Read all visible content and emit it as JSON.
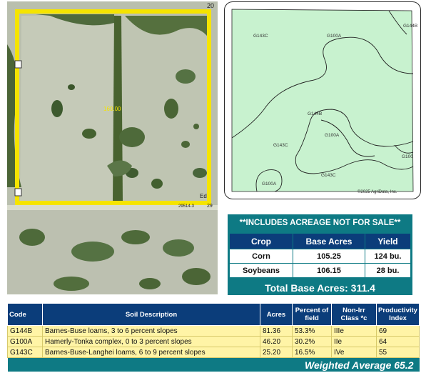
{
  "aerial": {
    "acreage_label": "160.00",
    "corner_number": "20",
    "corner_number_2": "29",
    "edge_text": "Ed",
    "bottom_text": "29514-3",
    "boundary_color": "#f5e400"
  },
  "soil_map": {
    "labels": [
      "G143C",
      "G100A",
      "G144B",
      "G144B",
      "G100A",
      "G143C",
      "G100A",
      "G143C",
      "G100"
    ],
    "copyright": "©2025 AgriData, Inc."
  },
  "base_acres": {
    "header": "**INCLUDES ACREAGE NOT FOR SALE**",
    "columns": [
      "Crop",
      "Base Acres",
      "Yield"
    ],
    "rows": [
      [
        "Corn",
        "105.25",
        "124 bu."
      ],
      [
        "Soybeans",
        "106.15",
        "28 bu."
      ]
    ],
    "total_label": "Total Base Acres:",
    "total_value": "311.4",
    "colors": {
      "teal": "#0e7a84",
      "navy": "#0b3d7a"
    }
  },
  "soil_table": {
    "columns": [
      "Code",
      "Soil Description",
      "Acres",
      "Percent of field",
      "Non-Irr Class *c",
      "Productivity Index"
    ],
    "rows": [
      [
        "G144B",
        "Barnes-Buse loams, 3 to 6 percent slopes",
        "81.36",
        "53.3%",
        "IIIe",
        "69"
      ],
      [
        "G100A",
        "Hamerly-Tonka complex, 0 to 3 percent slopes",
        "46.20",
        "30.2%",
        "IIe",
        "64"
      ],
      [
        "G143C",
        "Barnes-Buse-Langhei loams, 6 to 9 percent slopes",
        "25.20",
        "16.5%",
        "IVe",
        "55"
      ]
    ],
    "weighted_label": "Weighted Average",
    "weighted_value": "65.2",
    "row_color": "#fff4a6"
  }
}
